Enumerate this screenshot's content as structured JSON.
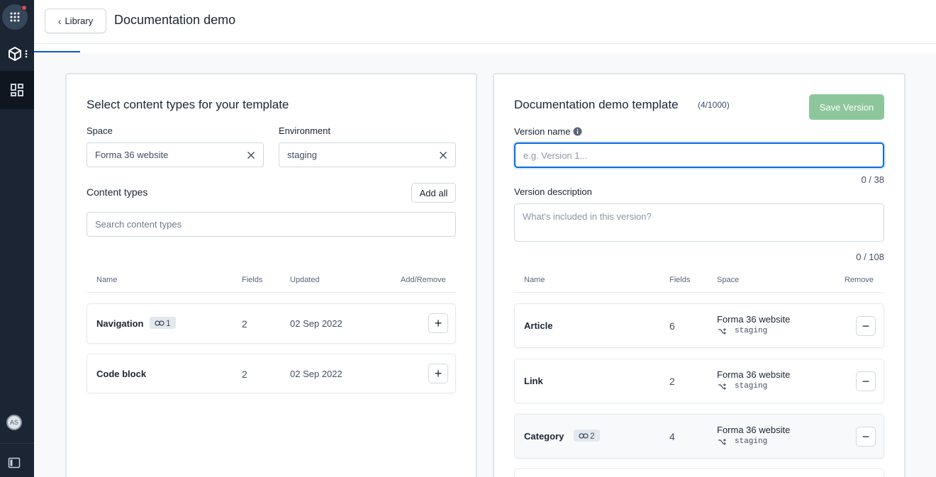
{
  "header": {
    "back_label": "Library",
    "title": "Documentation demo"
  },
  "nav": {
    "avatar_initials": "AS"
  },
  "left_panel": {
    "title": "Select content types for your template",
    "space_label": "Space",
    "space_value": "Forma 36 website",
    "environment_label": "Environment",
    "environment_value": "staging",
    "content_types_label": "Content types",
    "add_all_label": "Add all",
    "search_placeholder": "Search content types",
    "columns": [
      "Name",
      "Fields",
      "Updated",
      "Add/Remove"
    ],
    "rows": [
      {
        "name": "Navigation",
        "ref_count": "1",
        "fields": "2",
        "updated": "02 Sep 2022"
      },
      {
        "name": "Code block",
        "fields": "2",
        "updated": "02 Sep 2022"
      }
    ]
  },
  "right_panel": {
    "title": "Documentation demo template",
    "count": "(4/1000)",
    "save_label": "Save Version",
    "version_name_label": "Version name",
    "version_name_placeholder": "e.g. Version 1...",
    "version_name_counter": "0 / 38",
    "version_desc_label": "Version description",
    "version_desc_placeholder": "What's included in this version?",
    "version_desc_counter": "0 / 108",
    "columns": [
      "Name",
      "Fields",
      "Space",
      "Remove"
    ],
    "rows": [
      {
        "name": "Article",
        "fields": "6",
        "space": "Forma 36 website",
        "env": "staging"
      },
      {
        "name": "Link",
        "fields": "2",
        "space": "Forma 36 website",
        "env": "staging"
      },
      {
        "name": "Category",
        "ref_count": "2",
        "fields": "4",
        "space": "Forma 36 website",
        "env": "staging"
      }
    ]
  },
  "colors": {
    "nav_bg": "#1b2533",
    "accent_blue": "#0b6be0",
    "save_green": "#8dc69b"
  }
}
